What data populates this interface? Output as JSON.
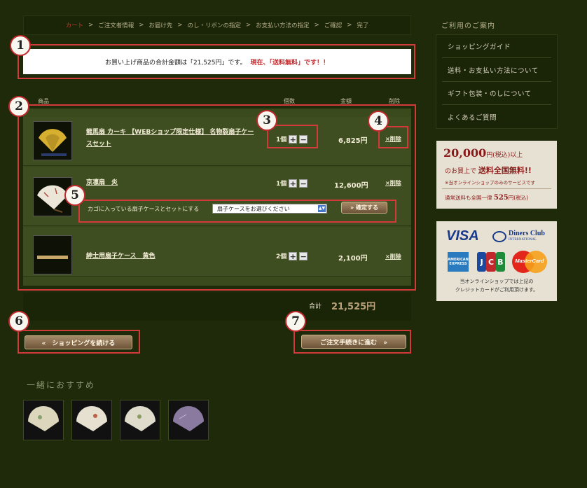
{
  "breadcrumb": {
    "steps": [
      "カート",
      "ご注文者情報",
      "お届け先",
      "のし・リボンの指定",
      "お支払い方法の指定",
      "ご確認",
      "完了"
    ],
    "separator": ">"
  },
  "markers": [
    "1",
    "2",
    "3",
    "4",
    "5",
    "6",
    "7"
  ],
  "notice": {
    "text": "お買い上げ商品の合計金額は「21,525円」です。",
    "free_text": "現在、「送料無料」です！！"
  },
  "columns": {
    "product": "商品",
    "quantity": "個数",
    "price": "金額",
    "delete": "削除"
  },
  "cart": {
    "items": [
      {
        "name_line1": "龍馬扇 カーキ 【WEBショップ限定仕様】 名物裂扇子ケー",
        "name_line2": "スセット",
        "qty": "1個",
        "price": "6,825円",
        "delete": "×削除"
      },
      {
        "name_line1": "京凛扇　炎",
        "name_line2": "",
        "qty": "1個",
        "price": "12,600円",
        "delete": "×削除"
      },
      {
        "name_line1": "紳士用扇子ケース　黄色",
        "name_line2": "",
        "qty": "2個",
        "price": "2,100円",
        "delete": "×削除"
      }
    ],
    "plus": "+",
    "minus": "−",
    "case_label": "カゴに入っている扇子ケースとセットにする",
    "case_select_value": "扇子ケースをお選びください",
    "confirm_button": "» 確定する",
    "total_label": "合計",
    "total_value": "21,525円"
  },
  "actions": {
    "continue_shopping": "«　ショッピングを続ける",
    "checkout": "ご注文手続きに進む　»"
  },
  "sidebar": {
    "guide_title": "ご利用のご案内",
    "guide_items": [
      "ショッピングガイド",
      "送料・お支払い方法について",
      "ギフト包装・のしについて",
      "よくあるご質問"
    ],
    "shipping": {
      "amount": "20,000",
      "amount_suffix": "円",
      "tax": "(税込)",
      "over": "以上",
      "line2_prefix": "のお買上で",
      "line2_bold": "送料全国無料!!",
      "line3": "※当オンラインショップのみのサービスです",
      "line4_prefix": "通常送料も全国一律",
      "line4_amount": "525",
      "line4_suffix": "円",
      "line4_tax": "(税込)"
    },
    "cards": {
      "visa": "VISA",
      "diners": "Diners Club",
      "diners_sub": "INTERNATIONAL",
      "amex": "AMERICAN EXPRESS",
      "jcb": [
        "J",
        "C",
        "B"
      ],
      "mastercard": "MasterCard",
      "note_line1": "当オンラインショップでは上記の",
      "note_line2": "クレジットカードがご利用頂けます。"
    }
  },
  "recommend": {
    "title": "一緒におすすめ",
    "count": 4
  }
}
